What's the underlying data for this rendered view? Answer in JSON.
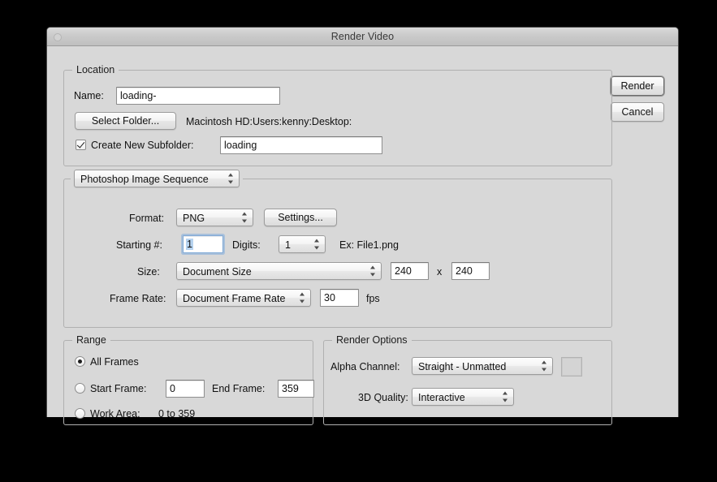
{
  "window": {
    "title": "Render Video",
    "close_icon": "close-icon"
  },
  "actions": {
    "render_label": "Render",
    "cancel_label": "Cancel"
  },
  "location": {
    "group_label": "Location",
    "name_label": "Name:",
    "name_value": "loading-",
    "select_folder_label": "Select Folder...",
    "path_text": "Macintosh HD:Users:kenny:Desktop:",
    "create_subfolder_label": "Create New Subfolder:",
    "create_subfolder_checked": true,
    "subfolder_value": "loading"
  },
  "format": {
    "output_type": "Photoshop Image Sequence",
    "format_label": "Format:",
    "format_value": "PNG",
    "settings_label": "Settings...",
    "starting_label": "Starting #:",
    "starting_value": "1",
    "digits_label": "Digits:",
    "digits_value": "1",
    "example_label": "Ex: File1.png",
    "size_label": "Size:",
    "size_value": "Document Size",
    "width_value": "240",
    "times_symbol": "x",
    "height_value": "240",
    "frame_rate_label": "Frame Rate:",
    "frame_rate_value": "Document Frame Rate",
    "fps_value": "30",
    "fps_unit": "fps"
  },
  "range": {
    "group_label": "Range",
    "all_frames_label": "All Frames",
    "all_frames_selected": true,
    "start_frame_label": "Start Frame:",
    "start_frame_value": "0",
    "end_frame_label": "End Frame:",
    "end_frame_value": "359",
    "work_area_label": "Work Area:",
    "work_area_value": "0 to 359"
  },
  "render_options": {
    "group_label": "Render Options",
    "alpha_label": "Alpha Channel:",
    "alpha_value": "Straight - Unmatted",
    "quality_label": "3D Quality:",
    "quality_value": "Interactive"
  },
  "colors": {
    "dialog_bg": "#d8d8d8",
    "desktop_bg": "#000000",
    "field_bg": "#ffffff",
    "selection_blue": "#b6d3f0",
    "focus_ring": "#7fa9d6"
  }
}
